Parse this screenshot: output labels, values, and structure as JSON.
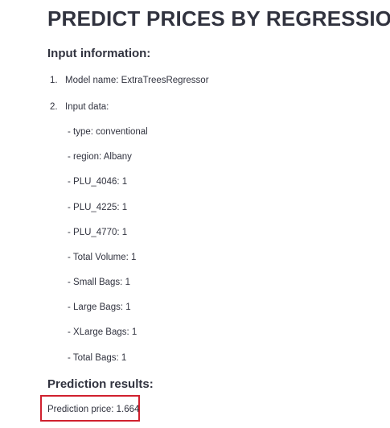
{
  "page": {
    "title": "PREDICT PRICES BY REGRESSION"
  },
  "input_section": {
    "heading": "Input information:",
    "items": [
      {
        "number": "1.",
        "label": "Model name: ExtraTreesRegressor"
      },
      {
        "number": "2.",
        "label": "Input data:"
      }
    ],
    "input_data": [
      "- type: conventional",
      "- region: Albany",
      "- PLU_4046: 1",
      "- PLU_4225: 1",
      "- PLU_4770: 1",
      "- Total Volume: 1",
      "- Small Bags: 1",
      "- Large Bags: 1",
      "- XLarge Bags: 1",
      "- Total Bags: 1"
    ]
  },
  "results_section": {
    "heading": "Prediction results:",
    "prediction_text": "Prediction price: 1.664"
  },
  "colors": {
    "highlight_border": "#d0202e",
    "text": "#31333f"
  }
}
